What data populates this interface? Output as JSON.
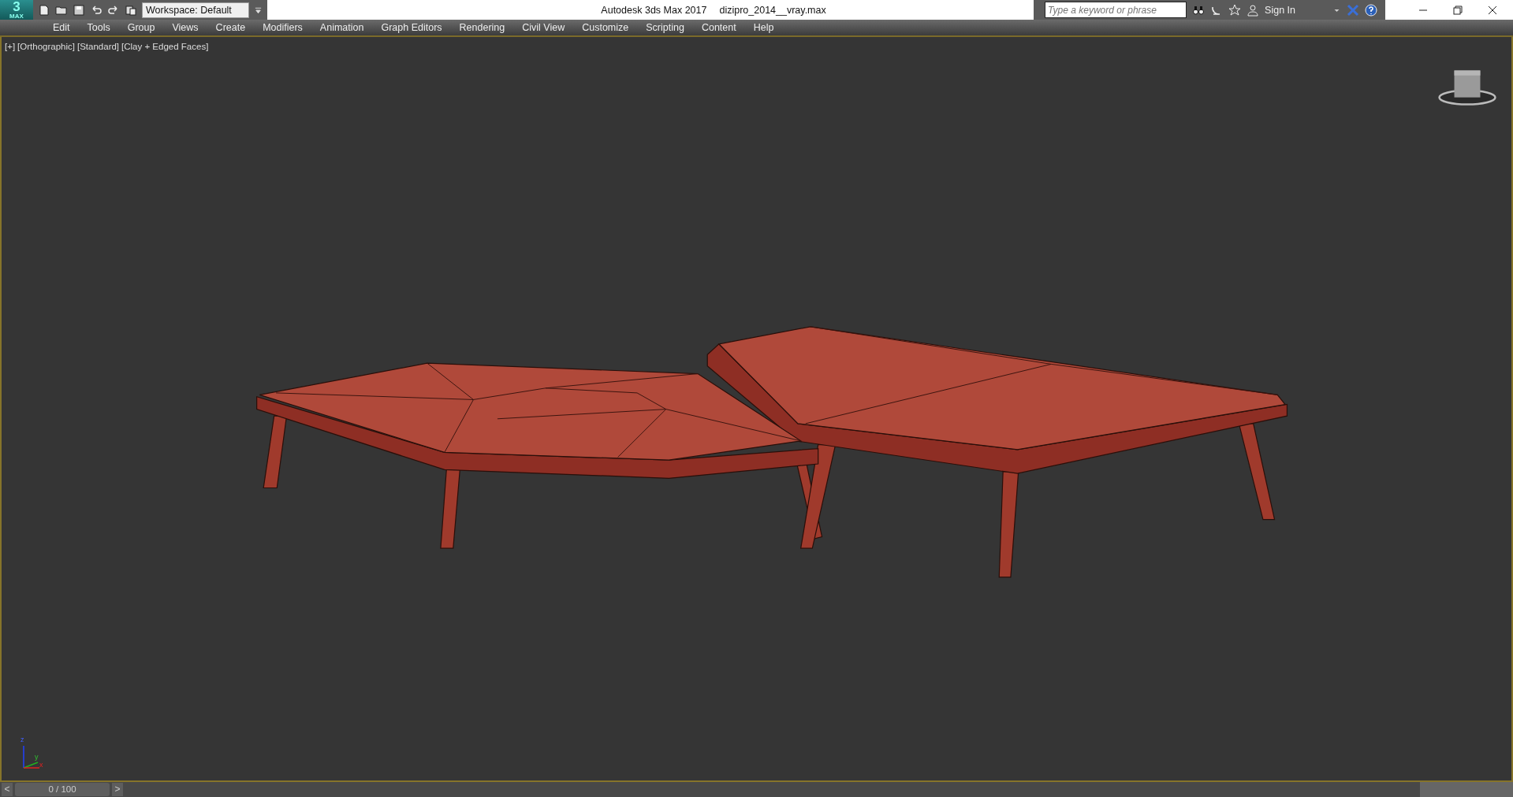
{
  "logo": {
    "number": "3",
    "label": "MAX"
  },
  "toolbar": {
    "workspace": "Workspace: Default"
  },
  "title_bar": {
    "app_title": "Autodesk 3ds Max 2017",
    "file_name": "dizipro_2014__vray.max"
  },
  "search": {
    "placeholder": "Type a keyword or phrase"
  },
  "sign_in": "Sign In",
  "menu": [
    "Edit",
    "Tools",
    "Group",
    "Views",
    "Create",
    "Modifiers",
    "Animation",
    "Graph Editors",
    "Rendering",
    "Civil View",
    "Customize",
    "Scripting",
    "Content",
    "Help"
  ],
  "viewport": {
    "labels": [
      "[+]",
      "[Orthographic]",
      "[Standard]",
      "[Clay + Edged Faces]"
    ],
    "axis_labels": [
      "z",
      "y",
      "x"
    ]
  },
  "timeline": {
    "prev": "<",
    "frame": "0 / 100",
    "next": ">"
  }
}
